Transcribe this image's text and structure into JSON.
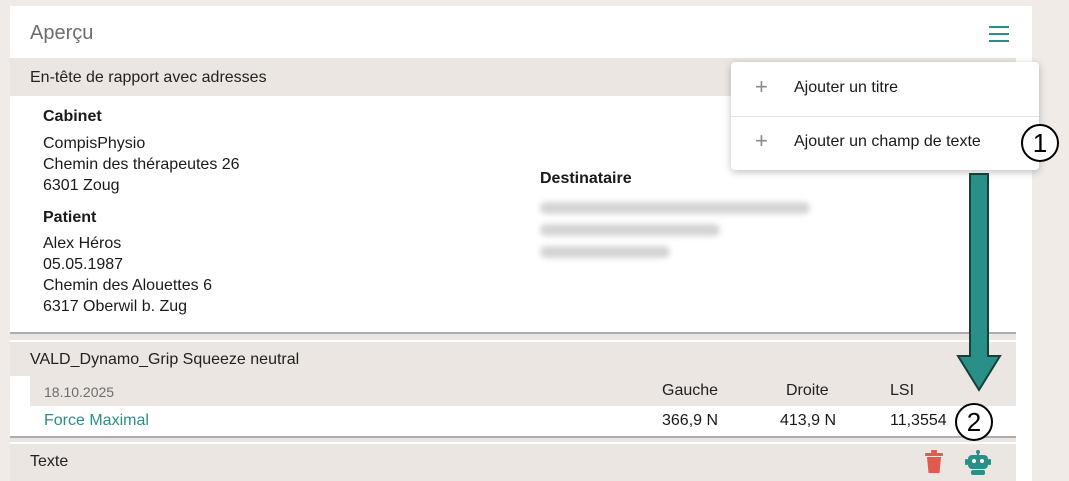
{
  "panel": {
    "title": "Aperçu",
    "menu_icon": "hamburger-menu-icon"
  },
  "report_header": {
    "title": "En-tête de rapport avec adresses",
    "cabinet": {
      "label": "Cabinet",
      "lines": [
        "CompisPhysio",
        "Chemin des thérapeutes 26",
        "6301 Zoug"
      ]
    },
    "patient": {
      "label": "Patient",
      "lines": [
        "Alex Héros",
        "05.05.1987",
        "Chemin des Alouettes 6",
        "6317 Oberwil b. Zug"
      ]
    },
    "recipient": {
      "label": "Destinataire"
    }
  },
  "measurement": {
    "title": "VALD_Dynamo_Grip Squeeze neutral",
    "date": "18.10.2025",
    "columns": [
      "Gauche",
      "Droite",
      "LSI"
    ],
    "rows": [
      {
        "name": "Force Maximal",
        "left": "366,9 N",
        "right": "413,9 N",
        "lsi": "11,3554"
      }
    ]
  },
  "text_section": {
    "title": "Texte",
    "icons": [
      "trash-icon",
      "robot-icon"
    ],
    "trash_color": "#e05a4e",
    "accent_color": "#2a8f86"
  },
  "dropdown": {
    "items": [
      {
        "icon": "plus-icon",
        "label": "Ajouter un titre"
      },
      {
        "icon": "plus-icon",
        "label": "Ajouter un champ de texte"
      }
    ]
  },
  "callouts": {
    "one": "1",
    "two": "2"
  }
}
